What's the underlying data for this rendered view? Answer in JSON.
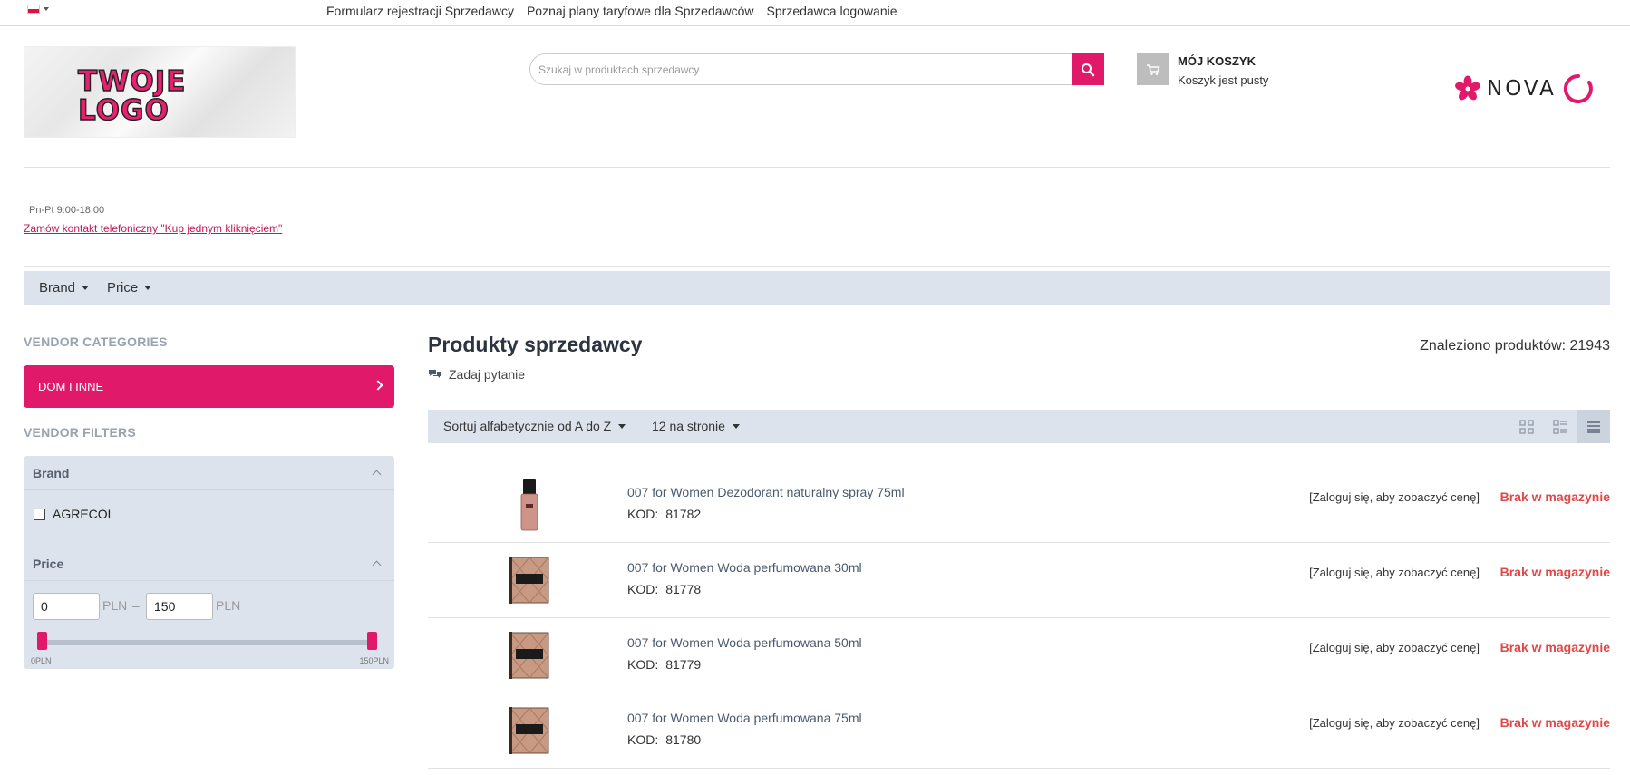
{
  "topbar": {
    "language_icon": "flag-pl-icon",
    "links": [
      "Formularz rejestracji Sprzedawcy",
      "Poznaj plany taryfowe dla Sprzedawców",
      "Sprzedawca logowanie"
    ]
  },
  "header": {
    "logo_text_line1": "TWOJE",
    "logo_text_line2": "LOGO",
    "search_placeholder": "Szukaj w produktach sprzedawcy",
    "search_value": "",
    "cart_title": "MÓJ KOSZYK",
    "cart_status": "Koszyk jest pusty",
    "vendor_logo_text": "NOVA"
  },
  "contact": {
    "hours": "Pn-Pt 9:00-18:00",
    "callback_link": "Zamów kontakt telefoniczny \"Kup jednym kliknięciem\""
  },
  "filter_bar": {
    "items": [
      "Brand",
      "Price"
    ]
  },
  "sidebar": {
    "categories_heading": "VENDOR CATEGORIES",
    "category_button": "DOM I INNE",
    "filters_heading": "VENDOR FILTERS",
    "brand_heading": "Brand",
    "brand_options": [
      {
        "label": "AGRECOL",
        "checked": false
      }
    ],
    "price_heading": "Price",
    "price_min": "0",
    "price_max": "150",
    "currency": "PLN",
    "range_separator": "–",
    "slider_min_label": "0PLN",
    "slider_max_label": "150PLN"
  },
  "main": {
    "title": "Produkty sprzedawcy",
    "found_text": "Znaleziono produktów: 21943",
    "ask_question": "Zadaj pytanie",
    "sort_label": "Sortuj alfabetycznie od A do Z",
    "per_page_label": "12 na stronie",
    "view_modes": [
      "grid-view-icon",
      "list-view-icon",
      "compact-list-view-icon"
    ],
    "active_view": "compact-list-view-icon",
    "kod_label": "KOD:",
    "products": [
      {
        "name": "007 for Women Dezodorant naturalny spray 75ml",
        "kod": "81782",
        "price_text": "[Zaloguj się, aby zobaczyć cenę]",
        "stock": "Brak w magazynie",
        "image": "spray-bottle"
      },
      {
        "name": "007 for Women Woda perfumowana 30ml",
        "kod": "81778",
        "price_text": "[Zaloguj się, aby zobaczyć cenę]",
        "stock": "Brak w magazynie",
        "image": "perfume-box"
      },
      {
        "name": "007 for Women Woda perfumowana 50ml",
        "kod": "81779",
        "price_text": "[Zaloguj się, aby zobaczyć cenę]",
        "stock": "Brak w magazynie",
        "image": "perfume-box"
      },
      {
        "name": "007 for Women Woda perfumowana 75ml",
        "kod": "81780",
        "price_text": "[Zaloguj się, aby zobaczyć cenę]",
        "stock": "Brak w magazynie",
        "image": "perfume-box"
      }
    ]
  },
  "colors": {
    "accent": "#e0196a",
    "panel": "#dde3ec",
    "out_of_stock": "#e04848"
  }
}
